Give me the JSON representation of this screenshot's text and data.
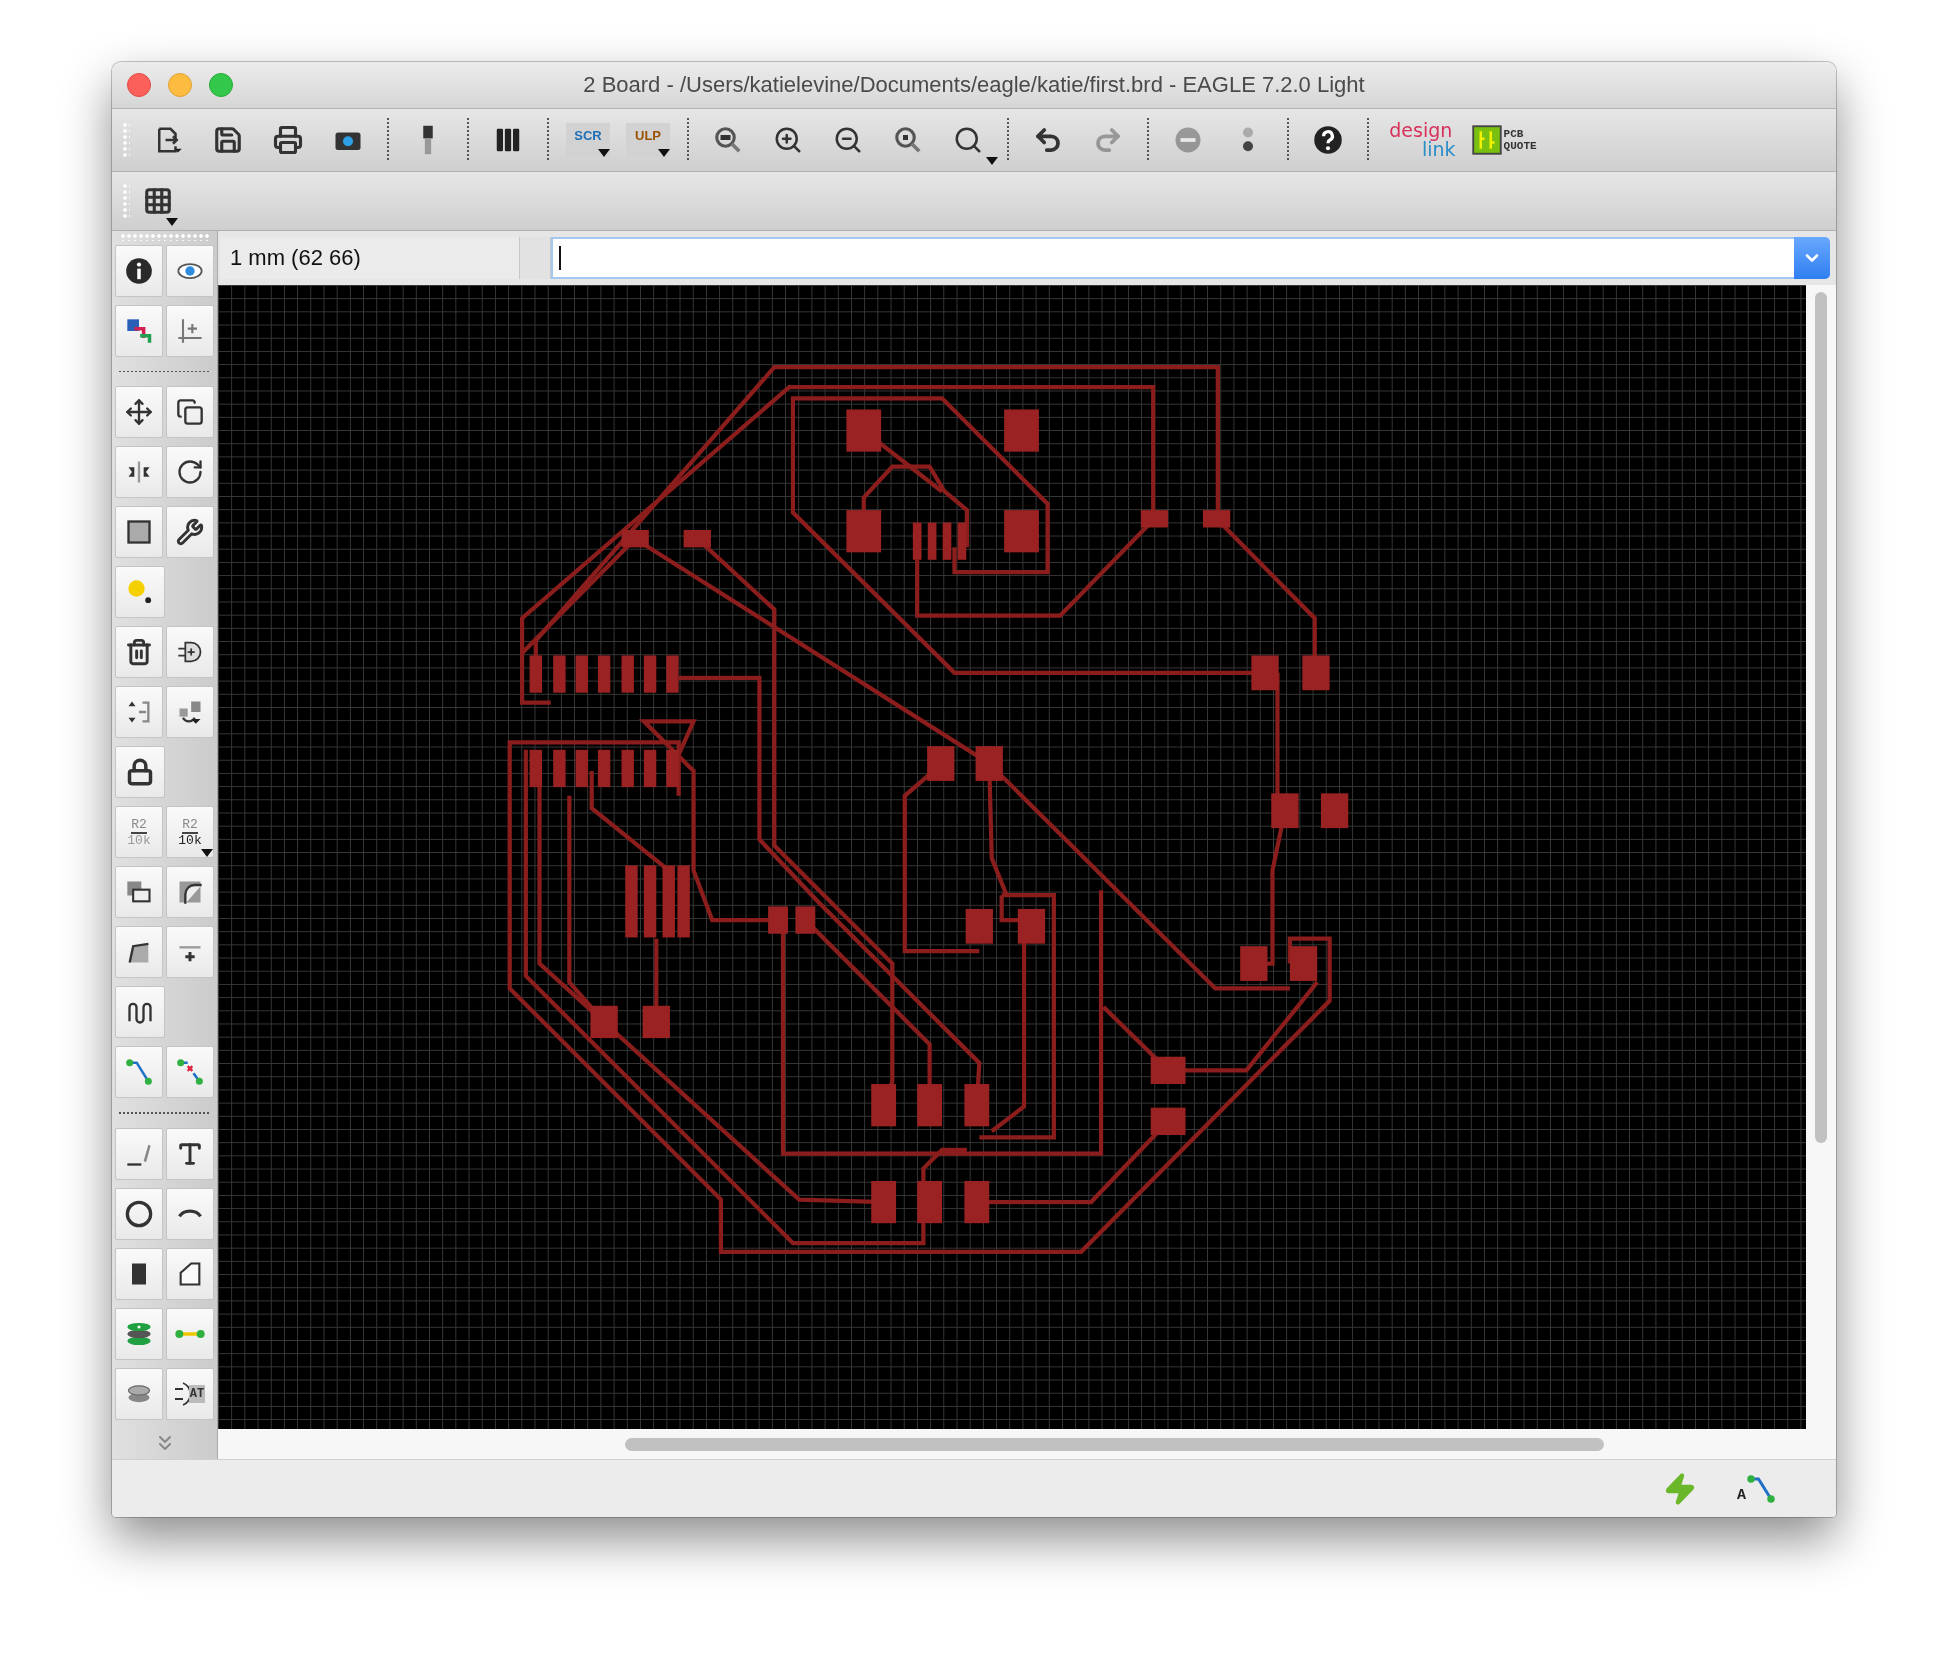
{
  "window": {
    "title": "2 Board - /Users/katielevine/Documents/eagle/katie/first.brd - EAGLE 7.2.0 Light"
  },
  "toolbar": {
    "groups": [
      [
        {
          "kind": "open",
          "disabled": false
        },
        {
          "kind": "save",
          "disabled": false
        },
        {
          "kind": "print",
          "disabled": false
        },
        {
          "kind": "camera",
          "disabled": false
        }
      ],
      [
        {
          "kind": "cam",
          "disabled": false
        }
      ],
      [
        {
          "kind": "layers",
          "disabled": false
        }
      ],
      [
        {
          "kind": "script",
          "label": "SCR",
          "disabled": false
        },
        {
          "kind": "ulp",
          "label": "ULP",
          "disabled": false
        }
      ],
      [
        {
          "kind": "zoom-fit",
          "disabled": false
        },
        {
          "kind": "zoom-in",
          "disabled": false
        },
        {
          "kind": "zoom-out",
          "disabled": false
        },
        {
          "kind": "zoom-select",
          "disabled": false
        },
        {
          "kind": "zoom-area",
          "disabled": false
        }
      ],
      [
        {
          "kind": "undo",
          "disabled": false
        },
        {
          "kind": "redo",
          "disabled": true
        }
      ],
      [
        {
          "kind": "stop",
          "disabled": true
        },
        {
          "kind": "go",
          "disabled": false
        }
      ],
      [
        {
          "kind": "help",
          "disabled": false
        }
      ],
      [
        {
          "kind": "designlink",
          "label": "design",
          "sublabel": "link",
          "disabled": false
        },
        {
          "kind": "pcbquote",
          "label": "PCB",
          "sublabel": "QUOTE",
          "disabled": false
        }
      ]
    ]
  },
  "grid_toolbar": {
    "items": [
      {
        "kind": "grid",
        "disabled": false
      }
    ]
  },
  "command_line": {
    "coordinates": "1 mm (62 66)"
  },
  "tool_palette": {
    "rows": [
      {
        "kind": "tools",
        "tools": [
          {
            "kind": "info"
          },
          {
            "kind": "show"
          }
        ]
      },
      {
        "kind": "tools",
        "tools": [
          {
            "kind": "display"
          },
          {
            "kind": "mark"
          }
        ]
      },
      {
        "kind": "separator"
      },
      {
        "kind": "tools",
        "tools": [
          {
            "kind": "move"
          },
          {
            "kind": "copy"
          }
        ]
      },
      {
        "kind": "tools",
        "tools": [
          {
            "kind": "mirror"
          },
          {
            "kind": "rotate"
          }
        ]
      },
      {
        "kind": "tools",
        "tools": [
          {
            "kind": "group"
          },
          {
            "kind": "change"
          }
        ]
      },
      {
        "kind": "tools",
        "tools": [
          {
            "kind": "dot"
          }
        ]
      },
      {
        "kind": "tools",
        "tools": [
          {
            "kind": "delete"
          },
          {
            "kind": "add"
          }
        ]
      },
      {
        "kind": "tools",
        "tools": [
          {
            "kind": "pinswap"
          },
          {
            "kind": "replace"
          }
        ]
      },
      {
        "kind": "tools",
        "tools": [
          {
            "kind": "lock"
          }
        ]
      },
      {
        "kind": "tools",
        "tools": [
          {
            "kind": "name",
            "label": "R2",
            "sublabel": "10k"
          },
          {
            "kind": "value",
            "label": "R2",
            "sublabel": "10k"
          }
        ]
      },
      {
        "kind": "tools",
        "tools": [
          {
            "kind": "smash"
          },
          {
            "kind": "miter"
          }
        ]
      },
      {
        "kind": "tools",
        "tools": [
          {
            "kind": "split"
          },
          {
            "kind": "optimize"
          }
        ]
      },
      {
        "kind": "tools",
        "tools": [
          {
            "kind": "meander"
          }
        ]
      },
      {
        "kind": "tools",
        "tools": [
          {
            "kind": "route"
          },
          {
            "kind": "ripup"
          }
        ]
      },
      {
        "kind": "separator"
      },
      {
        "kind": "tools",
        "tools": [
          {
            "kind": "wire"
          },
          {
            "kind": "text"
          }
        ]
      },
      {
        "kind": "tools",
        "tools": [
          {
            "kind": "circle"
          },
          {
            "kind": "arc"
          }
        ]
      },
      {
        "kind": "tools",
        "tools": [
          {
            "kind": "rect"
          },
          {
            "kind": "polygon"
          }
        ]
      },
      {
        "kind": "tools",
        "tools": [
          {
            "kind": "via"
          },
          {
            "kind": "signal"
          }
        ]
      },
      {
        "kind": "tools",
        "tools": [
          {
            "kind": "hole"
          },
          {
            "kind": "attribute",
            "label": "AT"
          }
        ]
      },
      {
        "kind": "more"
      }
    ]
  },
  "status_bar": {
    "items": [
      {
        "kind": "drc"
      },
      {
        "kind": "autorouter",
        "label": "A"
      }
    ]
  }
}
